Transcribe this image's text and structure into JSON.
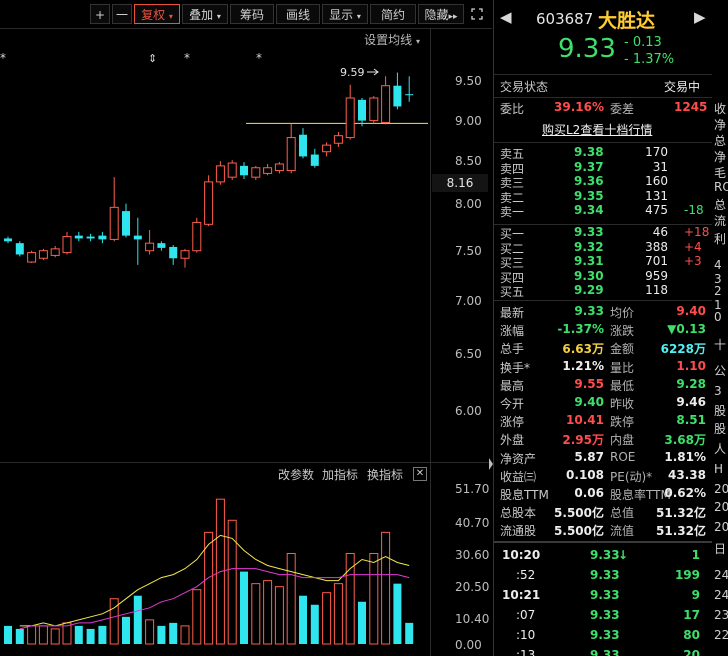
{
  "toolbar": {
    "plus": "+",
    "minus": "一",
    "fuquan": "复权",
    "diejia": "叠加",
    "chouma": "筹码",
    "huaxian": "画线",
    "xianshi": "显示",
    "jianyue": "简约",
    "yincang": "隐藏",
    "expand": "▸▸"
  },
  "ma_settings": "设置均线",
  "price_axis": [
    "9.50",
    "9.00",
    "8.50",
    "8.16",
    "8.00",
    "7.50",
    "7.00",
    "6.50",
    "6.00"
  ],
  "high_marker": "9.59",
  "indicator": {
    "gai": "改参数",
    "jia": "加指标",
    "huan": "换指标",
    "close": "✕",
    "axis": [
      "51.70",
      "40.70",
      "30.60",
      "20.50",
      "10.40",
      "0.00"
    ]
  },
  "chart_data": {
    "type": "candlestick",
    "candles": [
      {
        "o": 7.83,
        "c": 7.8,
        "h": 7.85,
        "l": 7.78
      },
      {
        "o": 7.78,
        "c": 7.66,
        "h": 7.8,
        "l": 7.64
      },
      {
        "o": 7.58,
        "c": 7.68,
        "h": 7.7,
        "l": 7.57
      },
      {
        "o": 7.62,
        "c": 7.7,
        "h": 7.72,
        "l": 7.6
      },
      {
        "o": 7.65,
        "c": 7.72,
        "h": 7.75,
        "l": 7.63
      },
      {
        "o": 7.68,
        "c": 7.85,
        "h": 7.9,
        "l": 7.66
      },
      {
        "o": 7.86,
        "c": 7.83,
        "h": 7.9,
        "l": 7.8
      },
      {
        "o": 7.85,
        "c": 7.83,
        "h": 7.88,
        "l": 7.8
      },
      {
        "o": 7.86,
        "c": 7.82,
        "h": 7.9,
        "l": 7.78
      },
      {
        "o": 7.82,
        "c": 8.16,
        "h": 8.48,
        "l": 7.8
      },
      {
        "o": 8.12,
        "c": 7.86,
        "h": 8.2,
        "l": 7.84
      },
      {
        "o": 7.86,
        "c": 7.82,
        "h": 8.05,
        "l": 7.55
      },
      {
        "o": 7.7,
        "c": 7.78,
        "h": 7.92,
        "l": 7.66
      },
      {
        "o": 7.78,
        "c": 7.73,
        "h": 7.8,
        "l": 7.7
      },
      {
        "o": 7.74,
        "c": 7.62,
        "h": 7.76,
        "l": 7.55
      },
      {
        "o": 7.62,
        "c": 7.7,
        "h": 7.72,
        "l": 7.52
      },
      {
        "o": 7.7,
        "c": 8.0,
        "h": 8.05,
        "l": 7.68
      },
      {
        "o": 7.98,
        "c": 8.43,
        "h": 8.5,
        "l": 7.96
      },
      {
        "o": 8.43,
        "c": 8.6,
        "h": 8.65,
        "l": 8.4
      },
      {
        "o": 8.48,
        "c": 8.63,
        "h": 8.66,
        "l": 8.45
      },
      {
        "o": 8.6,
        "c": 8.5,
        "h": 8.64,
        "l": 8.46
      },
      {
        "o": 8.48,
        "c": 8.58,
        "h": 8.6,
        "l": 8.45
      },
      {
        "o": 8.52,
        "c": 8.58,
        "h": 8.62,
        "l": 8.5
      },
      {
        "o": 8.55,
        "c": 8.62,
        "h": 8.64,
        "l": 8.52
      },
      {
        "o": 8.55,
        "c": 8.9,
        "h": 9.05,
        "l": 8.52
      },
      {
        "o": 8.93,
        "c": 8.7,
        "h": 9.0,
        "l": 8.68
      },
      {
        "o": 8.72,
        "c": 8.6,
        "h": 8.78,
        "l": 8.58
      },
      {
        "o": 8.75,
        "c": 8.82,
        "h": 8.85,
        "l": 8.7
      },
      {
        "o": 8.84,
        "c": 8.92,
        "h": 8.96,
        "l": 8.8
      },
      {
        "o": 8.9,
        "c": 9.32,
        "h": 9.46,
        "l": 8.88
      },
      {
        "o": 9.3,
        "c": 9.08,
        "h": 9.32,
        "l": 9.02
      },
      {
        "o": 9.08,
        "c": 9.32,
        "h": 9.34,
        "l": 9.05
      },
      {
        "o": 9.06,
        "c": 9.45,
        "h": 9.55,
        "l": 9.04
      },
      {
        "o": 9.45,
        "c": 9.23,
        "h": 9.59,
        "l": 9.2
      },
      {
        "o": 9.36,
        "c": 9.35,
        "h": 9.55,
        "l": 9.28
      }
    ],
    "volume": [
      6,
      5,
      6,
      6,
      5,
      7,
      6,
      5,
      6,
      15,
      9,
      16,
      8,
      6,
      7,
      6,
      18,
      37,
      48,
      41,
      24,
      20,
      21,
      19,
      30,
      16,
      13,
      17,
      20,
      30,
      14,
      30,
      37,
      20,
      7
    ],
    "ma_short": [
      6,
      6,
      7,
      6,
      7,
      8,
      9,
      10,
      12,
      15,
      18,
      20,
      22,
      23,
      25,
      28,
      33,
      36,
      35,
      31,
      28,
      26,
      25,
      24,
      23,
      22,
      21,
      21,
      25,
      28,
      27,
      29,
      27,
      26
    ],
    "ma_long": [
      5,
      6,
      6,
      6,
      6,
      7,
      7,
      8,
      9,
      10,
      11,
      12,
      14,
      15,
      17,
      19,
      22,
      24,
      25,
      25,
      25,
      24,
      23,
      23,
      22,
      22,
      22,
      22,
      23,
      23,
      23,
      23,
      23,
      22
    ],
    "support_line": 9.05
  },
  "quote": {
    "code": "603687",
    "name": "大胜达",
    "price": "9.33",
    "change": "- 0.13",
    "change_pct": "- 1.37%",
    "status_label": "交易状态",
    "status_value": "交易中",
    "weibi_label": "委比",
    "weibi_value": "39.16%",
    "weicha_label": "委差",
    "weicha_value": "1245",
    "l2_link": "购买L2查看十档行情",
    "asks": [
      {
        "label": "卖五",
        "price": "9.38",
        "vol": "170",
        "chg": ""
      },
      {
        "label": "卖四",
        "price": "9.37",
        "vol": "31",
        "chg": ""
      },
      {
        "label": "卖三",
        "price": "9.36",
        "vol": "160",
        "chg": ""
      },
      {
        "label": "卖二",
        "price": "9.35",
        "vol": "131",
        "chg": ""
      },
      {
        "label": "卖一",
        "price": "9.34",
        "vol": "475",
        "chg": "-18"
      }
    ],
    "bids": [
      {
        "label": "买一",
        "price": "9.33",
        "vol": "46",
        "chg": "+18"
      },
      {
        "label": "买二",
        "price": "9.32",
        "vol": "388",
        "chg": "+4"
      },
      {
        "label": "买三",
        "price": "9.31",
        "vol": "701",
        "chg": "+3"
      },
      {
        "label": "买四",
        "price": "9.30",
        "vol": "959",
        "chg": ""
      },
      {
        "label": "买五",
        "price": "9.29",
        "vol": "118",
        "chg": ""
      }
    ],
    "stats": [
      {
        "l1": "最新",
        "v1": "9.33",
        "c1": "green",
        "l2": "均价",
        "v2": "9.40",
        "c2": "red"
      },
      {
        "l1": "涨幅",
        "v1": "-1.37%",
        "c1": "green",
        "l2": "涨跌",
        "v2": "▼0.13",
        "c2": "green"
      },
      {
        "l1": "总手",
        "v1": "6.63万",
        "c1": "yellow",
        "l2": "金额",
        "v2": "6228万",
        "c2": "cyan"
      },
      {
        "l1": "换手*",
        "v1": "1.21%",
        "c1": "white",
        "l2": "量比",
        "v2": "1.10",
        "c2": "red"
      },
      {
        "l1": "最高",
        "v1": "9.55",
        "c1": "red",
        "l2": "最低",
        "v2": "9.28",
        "c2": "green"
      },
      {
        "l1": "今开",
        "v1": "9.40",
        "c1": "green",
        "l2": "昨收",
        "v2": "9.46",
        "c2": "white"
      },
      {
        "l1": "涨停",
        "v1": "10.41",
        "c1": "red",
        "l2": "跌停",
        "v2": "8.51",
        "c2": "green"
      },
      {
        "l1": "外盘",
        "v1": "2.95万",
        "c1": "red",
        "l2": "内盘",
        "v2": "3.68万",
        "c2": "green"
      },
      {
        "l1": "净资产",
        "v1": "5.87",
        "c1": "white",
        "l2": "ROE",
        "v2": "1.81%",
        "c2": "white"
      },
      {
        "l1": "收益㈢",
        "v1": "0.108",
        "c1": "white",
        "l2": "PE(动)*",
        "v2": "43.38",
        "c2": "white"
      },
      {
        "l1": "股息TTM",
        "v1": "0.06",
        "c1": "white",
        "l2": "股息率TTM",
        "v2": "0.62%",
        "c2": "white"
      },
      {
        "l1": "总股本",
        "v1": "5.500亿",
        "c1": "white",
        "l2": "总值",
        "v2": "51.32亿",
        "c2": "white"
      },
      {
        "l1": "流通股",
        "v1": "5.500亿",
        "c1": "white",
        "l2": "流值",
        "v2": "51.32亿",
        "c2": "white"
      }
    ],
    "ticks": [
      {
        "time": "10:20",
        "price": "9.33",
        "arrow": "↓",
        "vol": "1"
      },
      {
        "time": ":52",
        "price": "9.33",
        "arrow": "",
        "vol": "199"
      },
      {
        "time": "10:21",
        "price": "9.33",
        "arrow": "",
        "vol": "9"
      },
      {
        "time": ":07",
        "price": "9.33",
        "arrow": "",
        "vol": "17"
      },
      {
        "time": ":10",
        "price": "9.33",
        "arrow": "",
        "vol": "80"
      },
      {
        "time": ":13",
        "price": "9.33",
        "arrow": "",
        "vol": "20"
      }
    ]
  },
  "edge_labels": [
    "收",
    "净",
    "总",
    "净",
    "毛",
    "RO",
    "总",
    "流",
    "利",
    "4",
    "3",
    "2",
    "1",
    "0",
    "十",
    "公",
    "3",
    "股",
    "股",
    "人",
    "H",
    "20",
    "20",
    "20",
    "日",
    "24",
    "24",
    "23",
    "22"
  ]
}
